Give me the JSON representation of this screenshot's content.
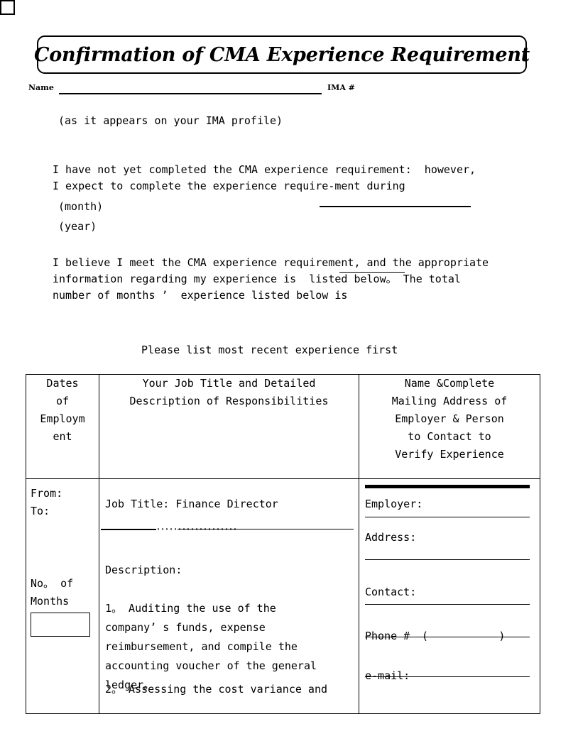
{
  "document": {
    "title": "Confirmation of CMA Experience Requirement",
    "name_label": "Name",
    "ima_label": "IMA #",
    "profile_note": "(as it appears on your IMA profile)",
    "checkbox_1_paragraph": "I have not yet completed the CMA experience requirement:  however,\nI expect to complete the experience require-ment during",
    "month_label": "(month)",
    "year_label": "(year)",
    "checkbox_2_paragraph": "I believe I meet the CMA experience requirement, and the appropriate\ninformation regarding my experience is  listed below。 The total\nnumber of months ’  experience listed below is",
    "instruction": "Please list most recent experience first"
  },
  "table": {
    "headers": {
      "col1": "Dates\nof\nEmploym\nent",
      "col2": "Your Job Title and Detailed\nDescription of Responsibilities",
      "col3": "Name &Complete\nMailing Address of\nEmployer & Person\nto Contact to\nVerify Experience"
    },
    "row": {
      "dates": {
        "from_label": "From:",
        "to_label": "To:",
        "months_label": "No。 of\nMonths",
        "months_value": ""
      },
      "description": {
        "job_title": "Job Title: Finance Director",
        "description_heading": "Description:",
        "item_1": "1。 Auditing the use of the\ncompany’ s funds,  expense\nreimbursement,  and compile the\naccounting voucher of the general\nledger。",
        "item_2": "2。 Assessing the cost variance and"
      },
      "employer": {
        "employer_label": "Employer:",
        "address_label": "Address:",
        "contact_label": "Contact:",
        "phone_label": "Phone # ",
        "phone_parens": "(           )",
        "email_label": "e-mail:"
      }
    }
  }
}
